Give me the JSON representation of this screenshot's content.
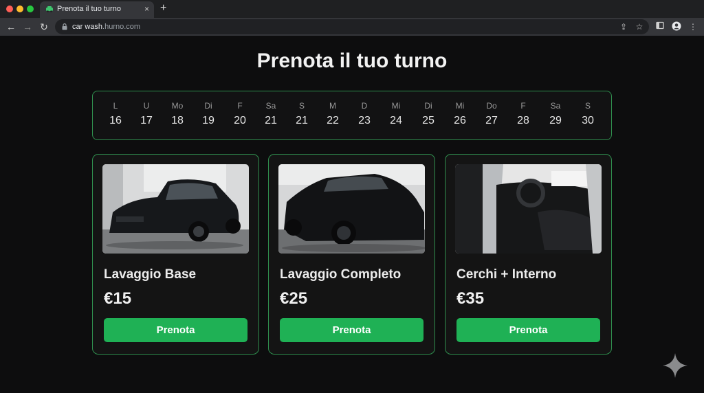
{
  "browser": {
    "tab_title": "Prenota il tuo turno",
    "tab_close": "×",
    "new_tab": "+",
    "url_host": "car wash",
    "url_rest": ".hurno.com"
  },
  "page": {
    "title": "Prenota il tuo turno"
  },
  "calendar": {
    "days": [
      {
        "name": "L",
        "num": "16"
      },
      {
        "name": "U",
        "num": "17"
      },
      {
        "name": "Mo",
        "num": "18"
      },
      {
        "name": "Di",
        "num": "19"
      },
      {
        "name": "F",
        "num": "20"
      },
      {
        "name": "Sa",
        "num": "21"
      },
      {
        "name": "S",
        "num": "21"
      },
      {
        "name": "M",
        "num": "22"
      },
      {
        "name": "D",
        "num": "23"
      },
      {
        "name": "Mi",
        "num": "24"
      },
      {
        "name": "Di",
        "num": "25"
      },
      {
        "name": "Mi",
        "num": "26"
      },
      {
        "name": "Do",
        "num": "27"
      },
      {
        "name": "F",
        "num": "28"
      },
      {
        "name": "Sa",
        "num": "29"
      },
      {
        "name": "S",
        "num": "30"
      }
    ]
  },
  "services": [
    {
      "name": "Lavaggio Base",
      "price": "€15",
      "button": "Prenota"
    },
    {
      "name": "Lavaggio Completo",
      "price": "€25",
      "button": "Prenota"
    },
    {
      "name": "Cerchi + Interno",
      "price": "€35",
      "button": "Prenota"
    }
  ],
  "colors": {
    "accent": "#1fb155",
    "border": "#2f8f4e",
    "background": "#0d0d0e"
  }
}
